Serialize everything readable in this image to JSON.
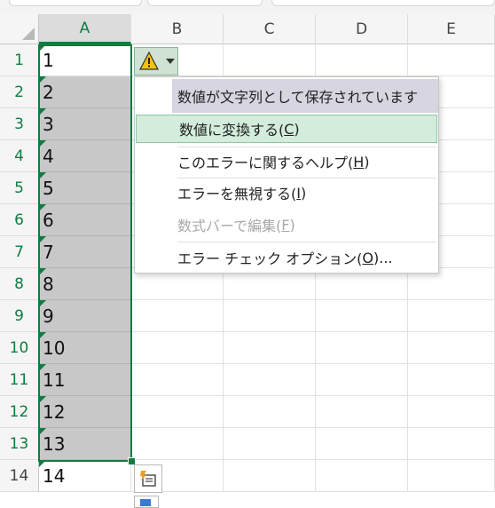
{
  "columns": [
    "A",
    "B",
    "C",
    "D",
    "E"
  ],
  "rows": [
    "1",
    "2",
    "3",
    "4",
    "5",
    "6",
    "7",
    "8",
    "9",
    "10",
    "11",
    "12",
    "13",
    "14"
  ],
  "cells_a": [
    "1",
    "2",
    "3",
    "4",
    "5",
    "6",
    "7",
    "8",
    "9",
    "10",
    "11",
    "12",
    "13",
    "14"
  ],
  "error_menu": {
    "header": "数値が文字列として保存されています",
    "items": [
      {
        "text": "数値に変換する(",
        "key": "C",
        "tail": ")"
      },
      {
        "text": "このエラーに関するヘルプ(",
        "key": "H",
        "tail": ")"
      },
      {
        "text": "エラーを無視する(",
        "key": "I",
        "tail": ")"
      },
      {
        "text": "数式バーで編集(",
        "key": "F",
        "tail": ")"
      },
      {
        "text": "エラー チェック オプション(",
        "key": "O",
        "tail": ")..."
      }
    ]
  },
  "colors": {
    "accent": "#107c41",
    "selection_shade": "#c8c8c8",
    "hover": "#d3ecdc"
  },
  "icons": {
    "error_button": "warning-triangle-icon",
    "quick_analysis": "paste-options-icon"
  }
}
